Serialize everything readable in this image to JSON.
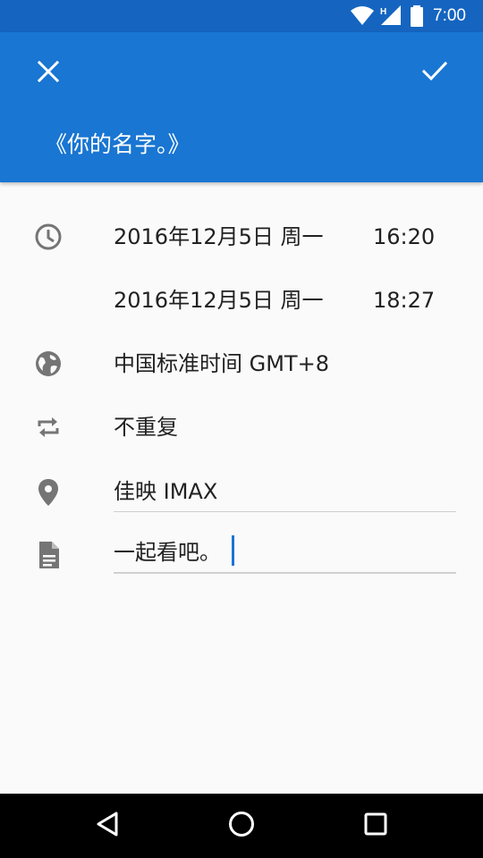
{
  "status_bar": {
    "time": "7:00",
    "network_label": "H",
    "icons": [
      "wifi-icon",
      "signal-icon",
      "battery-icon"
    ]
  },
  "app_bar": {
    "title": "《你的名字。》",
    "close_icon": "close-icon",
    "confirm_icon": "check-icon",
    "color": "#1976d2",
    "status_color": "#1565c0"
  },
  "event": {
    "start_date": "2016年12月5日 周一",
    "start_time": "16:20",
    "end_date": "2016年12月5日 周一",
    "end_time": "18:27",
    "timezone": "中国标准时间  GMT+8",
    "repeat": "不重复",
    "location": "佳映 IMAX",
    "note": "一起看吧。"
  },
  "row_icons": {
    "time": "clock-icon",
    "timezone": "globe-icon",
    "repeat": "repeat-icon",
    "location": "location-pin-icon",
    "note": "document-icon"
  },
  "nav_bar": {
    "icons": [
      "back-icon",
      "home-icon",
      "recents-icon"
    ]
  },
  "colors": {
    "accent": "#1976d2",
    "icon_grey": "#757575",
    "text": "#212121",
    "background": "#fafafa"
  }
}
